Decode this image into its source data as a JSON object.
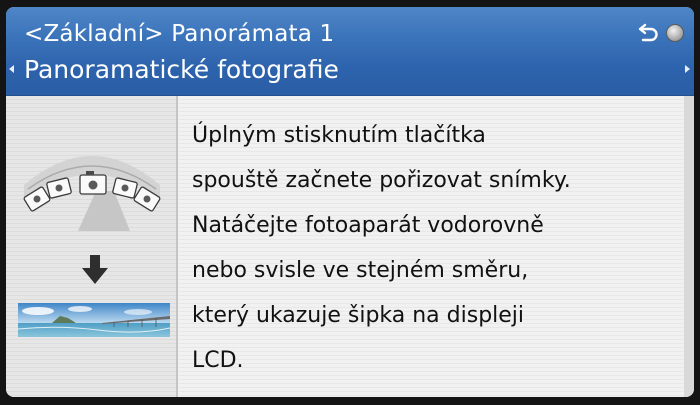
{
  "header": {
    "breadcrumb": "<Základní> Panorámata 1",
    "title": "Panoramatické fotografie"
  },
  "icons": {
    "back": "back-arrow-icon",
    "control_dial": "control-dial-icon",
    "scroll_left": "triangle-left-icon",
    "scroll_right": "triangle-right-icon",
    "down_arrow": "down-arrow-icon"
  },
  "content": {
    "description": "Úplným stisknutím tlačítka\nspouště začnete pořizovat snímky.\nNatáčejte fotoaparát vodorovně\nnebo svisle ve stejném směru,\nkterý ukazuje šipka na displeji\nLCD."
  },
  "colors": {
    "header_blue": "#2d63ac",
    "text": "#111111",
    "background": "#ececec"
  }
}
